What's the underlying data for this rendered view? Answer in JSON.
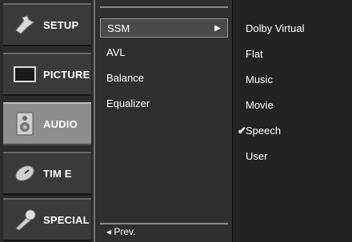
{
  "side_menu": {
    "items": [
      {
        "label": "SETUP",
        "icon": "setup-icon",
        "active": false
      },
      {
        "label": "PICTURE",
        "icon": "picture-icon",
        "active": false
      },
      {
        "label": "AUDIO",
        "icon": "speaker-icon",
        "active": true
      },
      {
        "label": "TIM E",
        "icon": "clock-icon",
        "active": false
      },
      {
        "label": "SPECIAL",
        "icon": "special-icon",
        "active": false
      }
    ]
  },
  "sub_menu": {
    "items": [
      {
        "label": "SSM",
        "selected": true
      },
      {
        "label": "AVL",
        "selected": false
      },
      {
        "label": "Balance",
        "selected": false
      },
      {
        "label": "Equalizer",
        "selected": false
      }
    ],
    "arrow": "▶",
    "prev_label": "◂ Prev."
  },
  "options": {
    "items": [
      {
        "label": "Dolby Virtual",
        "checked": false
      },
      {
        "label": "Flat",
        "checked": false
      },
      {
        "label": "Music",
        "checked": false
      },
      {
        "label": "Movie",
        "checked": false
      },
      {
        "label": "Speech",
        "checked": true
      },
      {
        "label": "User",
        "checked": false
      }
    ],
    "check_mark": "✔"
  }
}
